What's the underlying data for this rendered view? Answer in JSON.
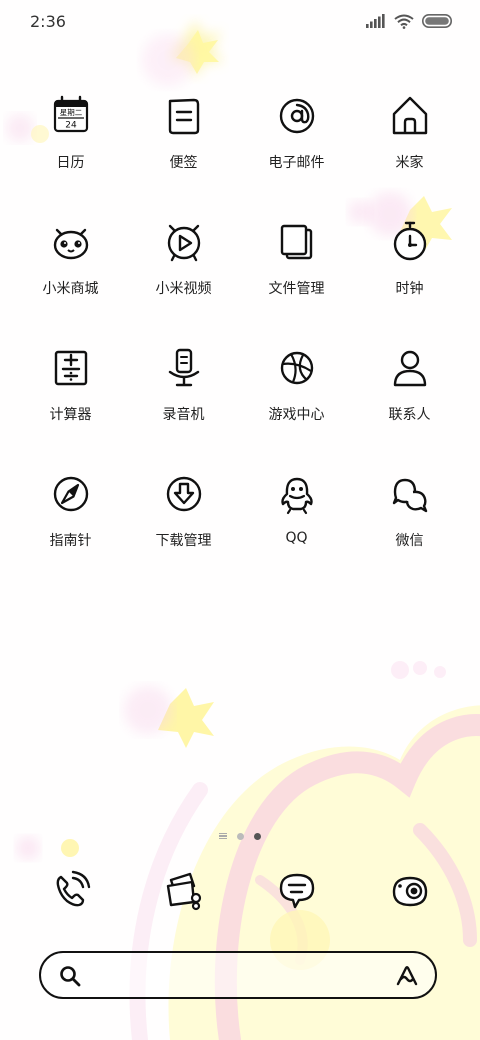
{
  "status_bar": {
    "time": "2:36"
  },
  "apps": [
    {
      "label": "日历",
      "icon": "calendar-icon",
      "calendar_weekday": "星期二",
      "calendar_day": "24"
    },
    {
      "label": "便签",
      "icon": "notes-icon"
    },
    {
      "label": "电子邮件",
      "icon": "email-icon"
    },
    {
      "label": "米家",
      "icon": "home-icon"
    },
    {
      "label": "小米商城",
      "icon": "store-icon"
    },
    {
      "label": "小米视频",
      "icon": "video-icon"
    },
    {
      "label": "文件管理",
      "icon": "files-icon"
    },
    {
      "label": "时钟",
      "icon": "clock-icon"
    },
    {
      "label": "计算器",
      "icon": "calculator-icon"
    },
    {
      "label": "录音机",
      "icon": "recorder-icon"
    },
    {
      "label": "游戏中心",
      "icon": "game-center-icon"
    },
    {
      "label": "联系人",
      "icon": "contacts-icon"
    },
    {
      "label": "指南针",
      "icon": "compass-icon"
    },
    {
      "label": "下载管理",
      "icon": "download-icon"
    },
    {
      "label": "QQ",
      "icon": "qq-icon"
    },
    {
      "label": "微信",
      "icon": "wechat-icon"
    }
  ],
  "dock": [
    {
      "icon": "phone-icon"
    },
    {
      "icon": "gallery-icon"
    },
    {
      "icon": "messages-icon"
    },
    {
      "icon": "camera-icon"
    }
  ],
  "page_indicator": {
    "pages": 2,
    "active": 2
  },
  "colors": {
    "wallpaper_pink": "#f7cde6",
    "wallpaper_yellow": "#fff8b5",
    "icon_stroke": "#111111"
  }
}
